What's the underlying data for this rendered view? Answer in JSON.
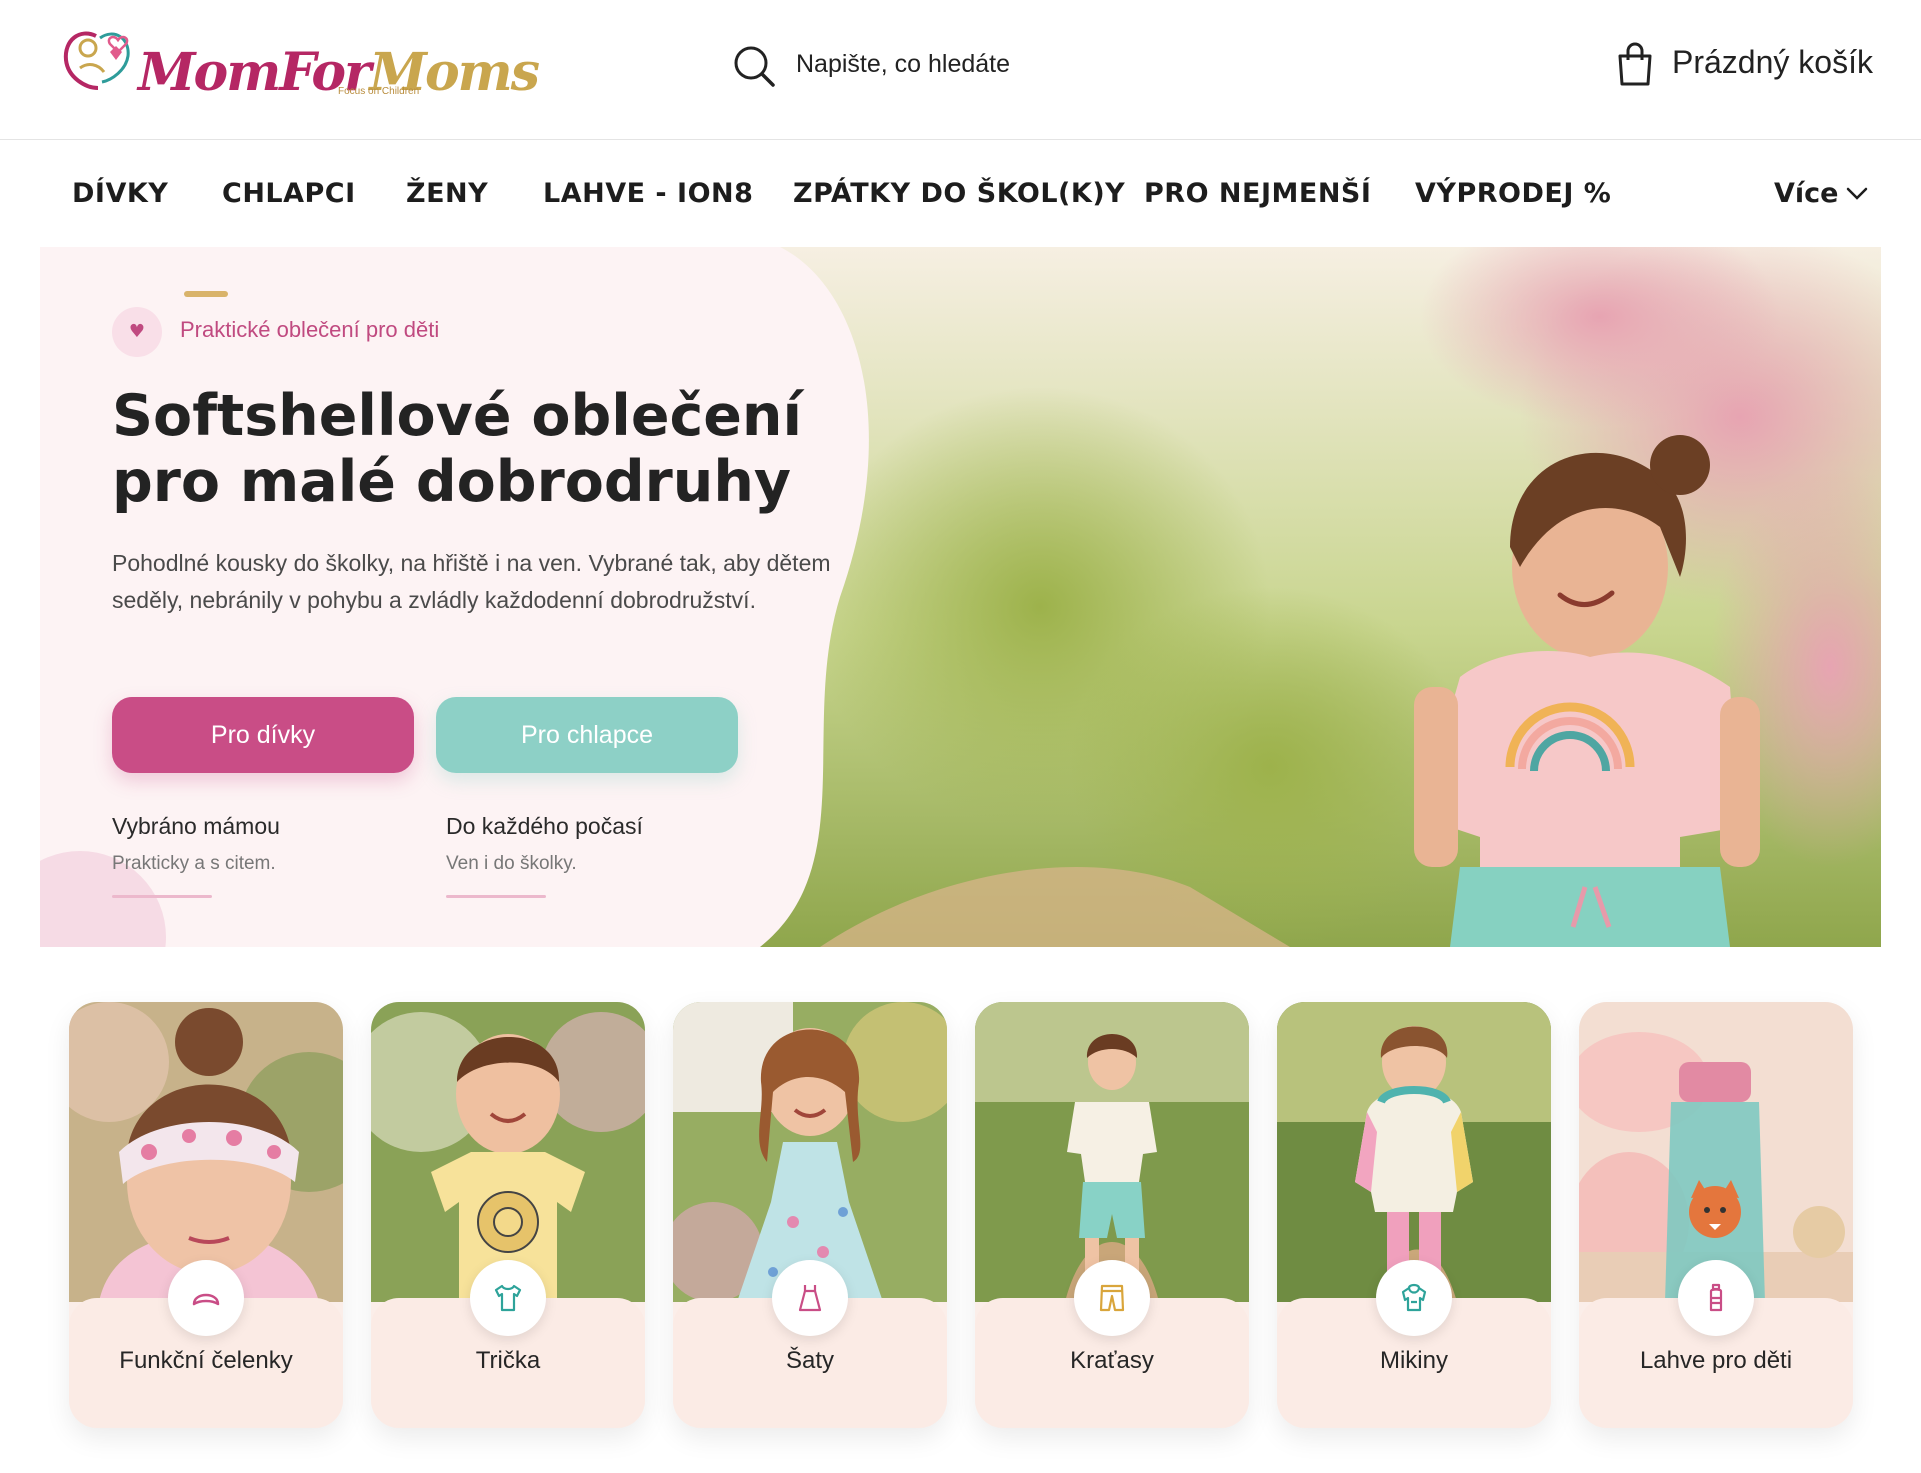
{
  "header": {
    "logo": {
      "text_mom": "Mom",
      "text_for": "For",
      "text_moms": "Moms",
      "tagline": "Focus on Children"
    },
    "search": {
      "placeholder": "Napište, co hledáte"
    },
    "cart": {
      "label": "Prázdný košík"
    }
  },
  "nav": {
    "items": [
      {
        "label": "DÍVKY"
      },
      {
        "label": "CHLAPCI"
      },
      {
        "label": "ŽENY"
      },
      {
        "label": "LAHVE - ION8"
      },
      {
        "label": "ZPÁTKY DO ŠKOL(K)Y"
      },
      {
        "label": "PRO NEJMENŠÍ"
      },
      {
        "label": "VÝPRODEJ %"
      }
    ],
    "more_label": "Více"
  },
  "hero": {
    "badge_icon": "heart-icon",
    "badge_text": "Praktické oblečení pro děti",
    "title_line1": "Softshellové oblečení",
    "title_line2": "pro malé dobrodruhy",
    "description": "Pohodlné kousky do školky, na hřiště i na ven. Vybrané tak, aby dětem seděly, nebránily v pohybu a zvládly každodenní dobrodružství.",
    "buttons": [
      {
        "label": "Pro dívky"
      },
      {
        "label": "Pro chlapce"
      }
    ],
    "features": [
      {
        "title": "Vybráno mámou",
        "subtitle": "Prakticky a s citem."
      },
      {
        "title": "Do každého počasí",
        "subtitle": "Ven i do školky."
      }
    ]
  },
  "categories": [
    {
      "label": "Funkční čelenky",
      "icon": "headband-icon"
    },
    {
      "label": "Trička",
      "icon": "tshirt-icon"
    },
    {
      "label": "Šaty",
      "icon": "dress-icon"
    },
    {
      "label": "Kraťasy",
      "icon": "shorts-icon"
    },
    {
      "label": "Mikiny",
      "icon": "hoodie-icon"
    },
    {
      "label": "Lahve pro děti",
      "icon": "bottle-icon"
    }
  ],
  "colors": {
    "brand_pink": "#c94d86",
    "brand_mint": "#8dd0c6",
    "brand_gold": "#d9b36a",
    "logo_magenta": "#b52764",
    "card_bg": "#fbebe5"
  }
}
